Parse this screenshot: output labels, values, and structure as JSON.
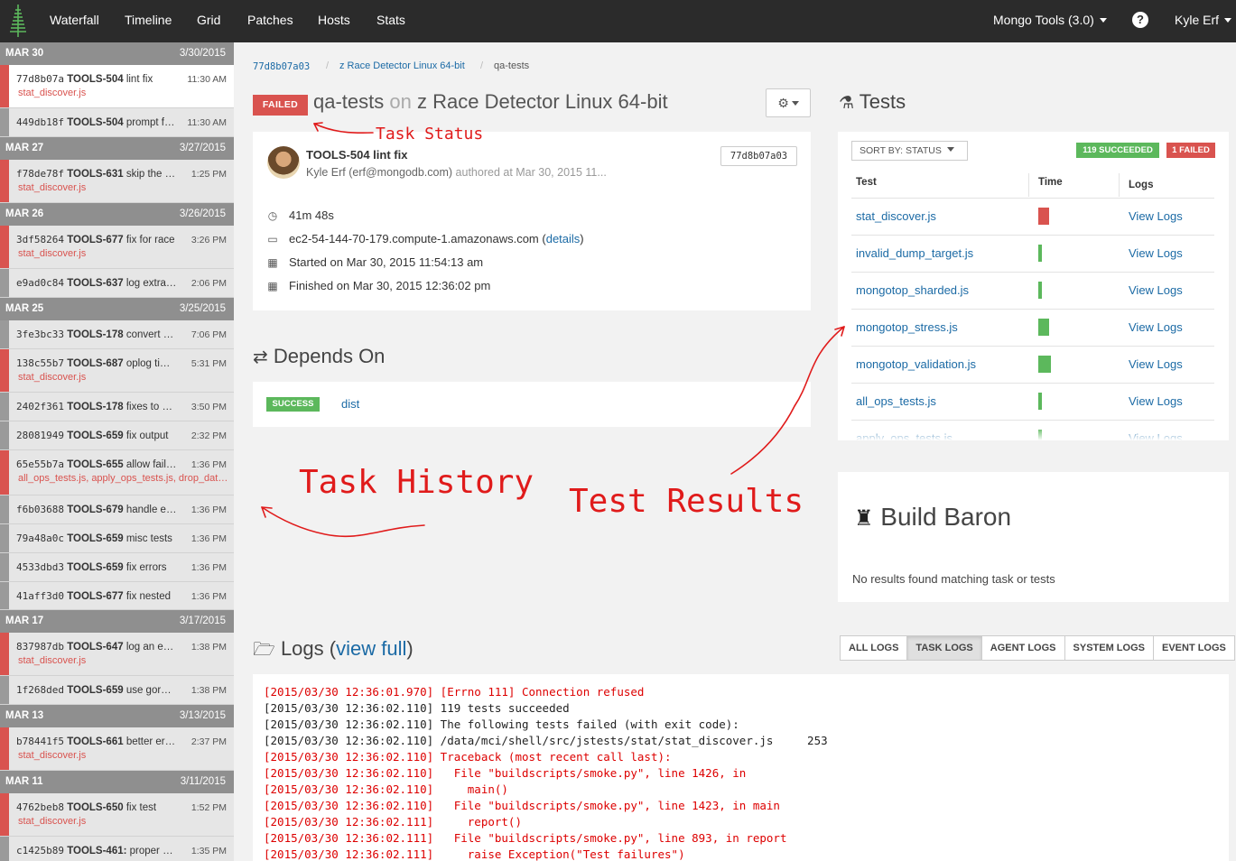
{
  "nav": {
    "logo": "evergreen-tree-icon",
    "links": [
      "Waterfall",
      "Timeline",
      "Grid",
      "Patches",
      "Hosts",
      "Stats"
    ],
    "project_selector": "Mongo Tools (3.0)",
    "user": "Kyle Erf"
  },
  "sidebar": {
    "days": [
      {
        "day": "MAR 30",
        "date": "3/30/2015"
      },
      {
        "day": "MAR 27",
        "date": "3/27/2015"
      },
      {
        "day": "MAR 26",
        "date": "3/26/2015"
      },
      {
        "day": "MAR 25",
        "date": "3/25/2015"
      },
      {
        "day": "MAR 17",
        "date": "3/17/2015"
      },
      {
        "day": "MAR 13",
        "date": "3/13/2015"
      },
      {
        "day": "MAR 11",
        "date": "3/11/2015"
      }
    ],
    "commits": [
      {
        "hash": "77d8b07a",
        "ticket": "TOOLS-504",
        "msg": "lint fix",
        "time": "11:30 AM",
        "fail": "stat_discover.js",
        "status": "failed"
      },
      {
        "hash": "449db18f",
        "ticket": "TOOLS-504",
        "msg": "prompt for password",
        "time": "11:30 AM",
        "fail": "",
        "status": "success"
      },
      {
        "hash": "f78de78f",
        "ticket": "TOOLS-631",
        "msg": "skip the test",
        "time": "1:25 PM",
        "fail": "stat_discover.js",
        "status": "failed"
      },
      {
        "hash": "3df58264",
        "ticket": "TOOLS-677",
        "msg": "fix for race",
        "time": "3:26 PM",
        "fail": "stat_discover.js",
        "status": "failed"
      },
      {
        "hash": "e9ad0c84",
        "ticket": "TOOLS-637",
        "msg": "log extra output",
        "time": "2:06 PM",
        "fail": "",
        "status": "success"
      },
      {
        "hash": "3fe3bc33",
        "ticket": "TOOLS-178",
        "msg": "convert options",
        "time": "7:06 PM",
        "fail": "",
        "status": "success"
      },
      {
        "hash": "138c55b7",
        "ticket": "TOOLS-687",
        "msg": "oplog timestamp",
        "time": "5:31 PM",
        "fail": "stat_discover.js",
        "status": "failed"
      },
      {
        "hash": "2402f361",
        "ticket": "TOOLS-178",
        "msg": "fixes to options",
        "time": "3:50 PM",
        "fail": "",
        "status": "success"
      },
      {
        "hash": "28081949",
        "ticket": "TOOLS-659",
        "msg": "fix output",
        "time": "2:32 PM",
        "fail": "",
        "status": "success"
      },
      {
        "hash": "65e55b7a",
        "ticket": "TOOLS-655",
        "msg": "allow failures",
        "time": "1:36 PM",
        "fail": "all_ops_tests.js, apply_ops_tests.js, drop_database.js",
        "status": "failed"
      },
      {
        "hash": "f6b03688",
        "ticket": "TOOLS-679",
        "msg": "handle errors",
        "time": "1:36 PM",
        "fail": "",
        "status": "success"
      },
      {
        "hash": "79a48a0c",
        "ticket": "TOOLS-659",
        "msg": "misc tests",
        "time": "1:36 PM",
        "fail": "",
        "status": "success"
      },
      {
        "hash": "4533dbd3",
        "ticket": "TOOLS-659",
        "msg": "fix errors",
        "time": "1:36 PM",
        "fail": "",
        "status": "success"
      },
      {
        "hash": "41aff3d0",
        "ticket": "TOOLS-677",
        "msg": "fix nested",
        "time": "1:36 PM",
        "fail": "",
        "status": "success"
      },
      {
        "hash": "837987db",
        "ticket": "TOOLS-647",
        "msg": "log an error",
        "time": "1:38 PM",
        "fail": "stat_discover.js",
        "status": "failed"
      },
      {
        "hash": "1f268ded",
        "ticket": "TOOLS-659",
        "msg": "use goroutines",
        "time": "1:38 PM",
        "fail": "",
        "status": "success"
      },
      {
        "hash": "b78441f5",
        "ticket": "TOOLS-661",
        "msg": "better errors",
        "time": "2:37 PM",
        "fail": "stat_discover.js",
        "status": "failed"
      },
      {
        "hash": "4762beb8",
        "ticket": "TOOLS-650",
        "msg": "fix test",
        "time": "1:52 PM",
        "fail": "stat_discover.js",
        "status": "failed"
      },
      {
        "hash": "c1425b89",
        "ticket": "TOOLS-461:",
        "msg": "proper handling",
        "time": "1:35 PM",
        "fail": "",
        "status": "success"
      }
    ]
  },
  "breadcrumb": {
    "commit": "77d8b07a03",
    "variant": "z Race Detector Linux 64-bit",
    "task": "qa-tests"
  },
  "task": {
    "status": "FAILED",
    "name": "qa-tests",
    "on": "on",
    "variant": "z Race Detector Linux 64-bit",
    "commit_title": "TOOLS-504 lint fix",
    "author": "Kyle Erf (erf@mongodb.com)",
    "authored_at": "authored at Mar 30, 2015 11...",
    "hash": "77d8b07a03",
    "duration": "41m 48s",
    "host": "ec2-54-144-70-179.compute-1.amazonaws.com",
    "details_link": "details",
    "started": "Started on Mar 30, 2015 11:54:13 am",
    "finished": "Finished on Mar 30, 2015 12:36:02 pm"
  },
  "depends": {
    "title": "Depends On",
    "items": [
      {
        "status": "SUCCESS",
        "name": "dist"
      }
    ]
  },
  "tests": {
    "title": "Tests",
    "sort_label": "SORT BY: STATUS",
    "succeeded": "119 SUCCEEDED",
    "failed": "1 FAILED",
    "headers": {
      "test": "Test",
      "time": "Time",
      "logs": "Logs"
    },
    "rows": [
      {
        "name": "stat_discover.js",
        "duration": 0.12,
        "status": "failed",
        "logs": "View Logs"
      },
      {
        "name": "invalid_dump_target.js",
        "duration": 0.04,
        "status": "success",
        "logs": "View Logs"
      },
      {
        "name": "mongotop_sharded.js",
        "duration": 0.04,
        "status": "success",
        "logs": "View Logs"
      },
      {
        "name": "mongotop_stress.js",
        "duration": 0.12,
        "status": "success",
        "logs": "View Logs"
      },
      {
        "name": "mongotop_validation.js",
        "duration": 0.14,
        "status": "success",
        "logs": "View Logs"
      },
      {
        "name": "all_ops_tests.js",
        "duration": 0.04,
        "status": "success",
        "logs": "View Logs"
      },
      {
        "name": "apply_ops_tests.js",
        "duration": 0.04,
        "status": "success",
        "logs": "View Logs"
      }
    ]
  },
  "build_baron": {
    "title": "Build Baron",
    "text": "No results found matching task or tests"
  },
  "logs": {
    "title": "Logs (",
    "view_full": "view full",
    "close": ")",
    "tabs": [
      "ALL LOGS",
      "TASK LOGS",
      "AGENT LOGS",
      "SYSTEM LOGS",
      "EVENT LOGS"
    ],
    "active_tab": "TASK LOGS",
    "lines": [
      {
        "text": "[2015/03/30 12:36:01.970] [Errno 111] Connection refused",
        "level": "err"
      },
      {
        "text": "[2015/03/30 12:36:02.110] 119 tests succeeded",
        "level": "ok"
      },
      {
        "text": "[2015/03/30 12:36:02.110] The following tests failed (with exit code):",
        "level": "ok"
      },
      {
        "text": "[2015/03/30 12:36:02.110] /data/mci/shell/src/jstests/stat/stat_discover.js     253",
        "level": "ok"
      },
      {
        "text": "[2015/03/30 12:36:02.110] Traceback (most recent call last):",
        "level": "err"
      },
      {
        "text": "[2015/03/30 12:36:02.110]   File \"buildscripts/smoke.py\", line 1426, in",
        "level": "err"
      },
      {
        "text": "[2015/03/30 12:36:02.110]     main()",
        "level": "err"
      },
      {
        "text": "[2015/03/30 12:36:02.110]   File \"buildscripts/smoke.py\", line 1423, in main",
        "level": "err"
      },
      {
        "text": "[2015/03/30 12:36:02.111]     report()",
        "level": "err"
      },
      {
        "text": "[2015/03/30 12:36:02.111]   File \"buildscripts/smoke.py\", line 893, in report",
        "level": "err"
      },
      {
        "text": "[2015/03/30 12:36:02.111]     raise Exception(\"Test failures\")",
        "level": "err"
      }
    ]
  },
  "annotations": {
    "task_status": "Task Status",
    "task_history": "Task History",
    "test_results": "Test Results"
  },
  "colors": {
    "failed": "#d9534f",
    "success": "#5cb85c",
    "link": "#1b6aa5",
    "annotation": "#e01b1b"
  }
}
